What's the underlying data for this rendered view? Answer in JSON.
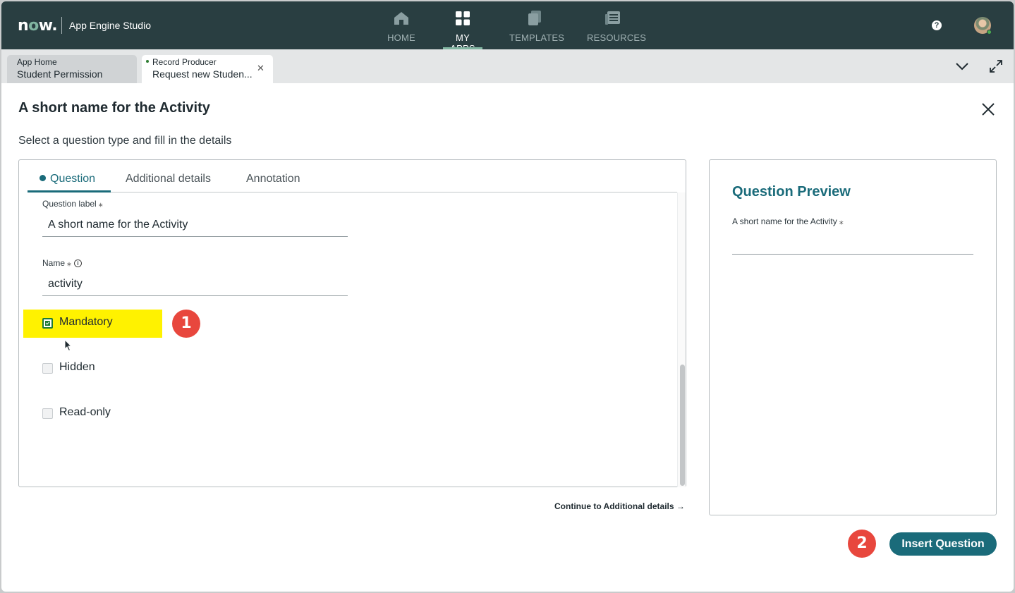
{
  "nav": {
    "logo": "now.",
    "app_name": "App Engine Studio",
    "items": [
      {
        "label": "HOME",
        "icon": "home-icon"
      },
      {
        "label": "MY APPS",
        "icon": "grid-icon"
      },
      {
        "label": "TEMPLATES",
        "icon": "templates-icon"
      },
      {
        "label": "RESOURCES",
        "icon": "resources-icon"
      }
    ],
    "active_item": "MY APPS",
    "help_label": "?"
  },
  "tabs": [
    {
      "title": "App Home",
      "subtitle": "Student Permission"
    },
    {
      "title": "Record Producer",
      "subtitle": "Request new Studen..."
    }
  ],
  "page": {
    "title": "A short name for the Activity",
    "subtitle": "Select a question type and fill in the details"
  },
  "panel_tabs": [
    "Question",
    "Additional details",
    "Annotation"
  ],
  "form": {
    "question_label": {
      "label": "Question label",
      "value": "A short name for the Activity"
    },
    "name": {
      "label": "Name",
      "value": "activity"
    },
    "checkboxes": [
      {
        "label": "Mandatory",
        "checked": true
      },
      {
        "label": "Hidden",
        "checked": false
      },
      {
        "label": "Read-only",
        "checked": false
      }
    ],
    "required_marker": "⁎"
  },
  "annotations": {
    "step1": "1",
    "step2": "2",
    "highlight_color": "#fff200",
    "badge_color": "#e8473d"
  },
  "continue_link": "Continue to Additional details →",
  "preview": {
    "title": "Question Preview",
    "field_label": "A short name for the Activity"
  },
  "insert_button": "Insert Question",
  "colors": {
    "nav_bg": "#293e41",
    "accent": "#1a6b7a",
    "nav_highlight": "#81b5a1"
  }
}
